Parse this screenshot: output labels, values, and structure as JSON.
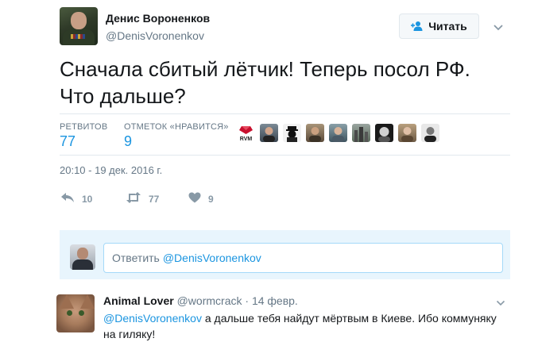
{
  "author": {
    "name": "Денис Вороненков",
    "handle": "@DenisVoronenkov"
  },
  "follow_button": {
    "label": "Читать",
    "icon": "add-user-icon"
  },
  "tweet": {
    "lines": [
      "Сначала сбитый лётчик! Теперь посол РФ.",
      "Что дальше?"
    ]
  },
  "stats": {
    "retweets_label": "РЕТВИТОВ",
    "retweets_count": "77",
    "likes_label": "ОТМЕТОК «НРАВИТСЯ»",
    "likes_count": "9"
  },
  "liker_avatars": [
    "rvm-logo",
    "man-portrait",
    "masked-figure",
    "portrait",
    "portrait",
    "landscape",
    "bw-portrait",
    "portrait",
    "bw-portrait"
  ],
  "timestamp": "20:10 - 19 дек. 2016 г.",
  "actions": {
    "reply_count": "10",
    "retweet_count": "77",
    "like_count": "9"
  },
  "reply_box": {
    "prefix": "Ответить",
    "mention": "@DenisVoronenkov"
  },
  "reply_tweet": {
    "name": "Animal Lover",
    "handle": "@wormcrack",
    "separator": "·",
    "date": "14 февр.",
    "mention": "@DenisVoronenkov",
    "text_line1": " а дальше тебя найдут мёртвым в Киеве. Ибо коммуняку",
    "text_line2": "на гиляку!"
  },
  "colors": {
    "accent": "#1b95e0",
    "muted": "#657786",
    "reply_bg": "#e8f5fd",
    "divider": "#e1e8ed"
  }
}
